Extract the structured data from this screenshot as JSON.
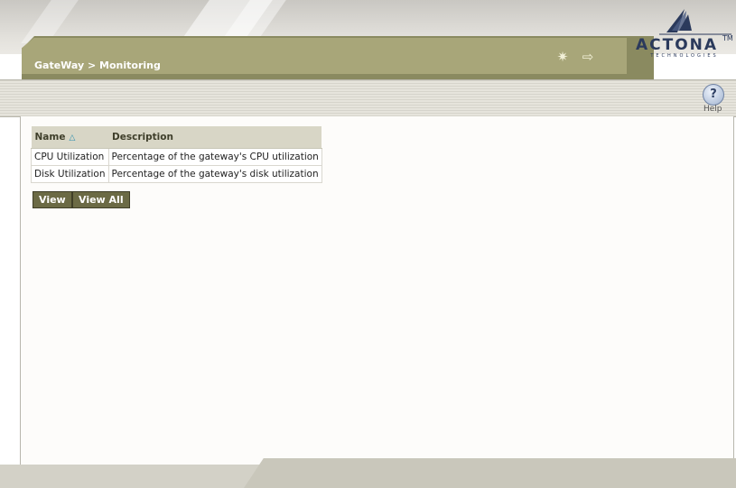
{
  "header": {
    "breadcrumb": "GateWay > Monitoring",
    "logo": {
      "name": "ACTONA",
      "tm": "TM",
      "subtitle": "TECHNOLOGIES"
    },
    "icons": [
      "wand-icon",
      "logout-icon"
    ]
  },
  "toolbar": {
    "help_label": "Help",
    "help_glyph": "?"
  },
  "table": {
    "columns": [
      {
        "label": "Name",
        "sort": "ascending"
      },
      {
        "label": "Description"
      }
    ],
    "rows": [
      {
        "name": "CPU Utilization",
        "description": "Percentage of the gateway's CPU utilization"
      },
      {
        "name": "Disk Utilization",
        "description": "Percentage of the gateway's disk utilization"
      }
    ]
  },
  "buttons": {
    "view": "View",
    "view_all": "View All"
  },
  "colors": {
    "accent_olive": "#6b6a45",
    "header_tan": "#a8a679",
    "logo_navy": "#2b3a5c"
  }
}
